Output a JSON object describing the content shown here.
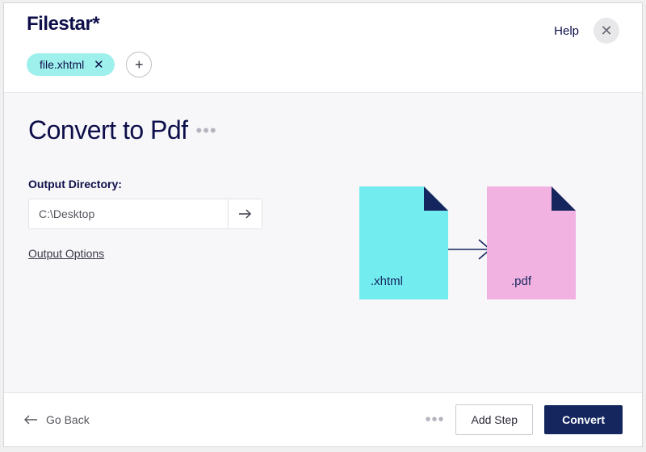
{
  "header": {
    "brand": "Filestar*",
    "help_label": "Help"
  },
  "file_chip": {
    "name": "file.xhtml"
  },
  "main": {
    "page_title": "Convert to Pdf",
    "output_label": "Output Directory:",
    "output_value": "C:\\Desktop",
    "options_label": "Output Options"
  },
  "diagram": {
    "source_ext": ".xhtml",
    "target_ext": ".pdf"
  },
  "footer": {
    "back_label": "Go Back",
    "add_step_label": "Add Step",
    "convert_label": "Convert"
  }
}
